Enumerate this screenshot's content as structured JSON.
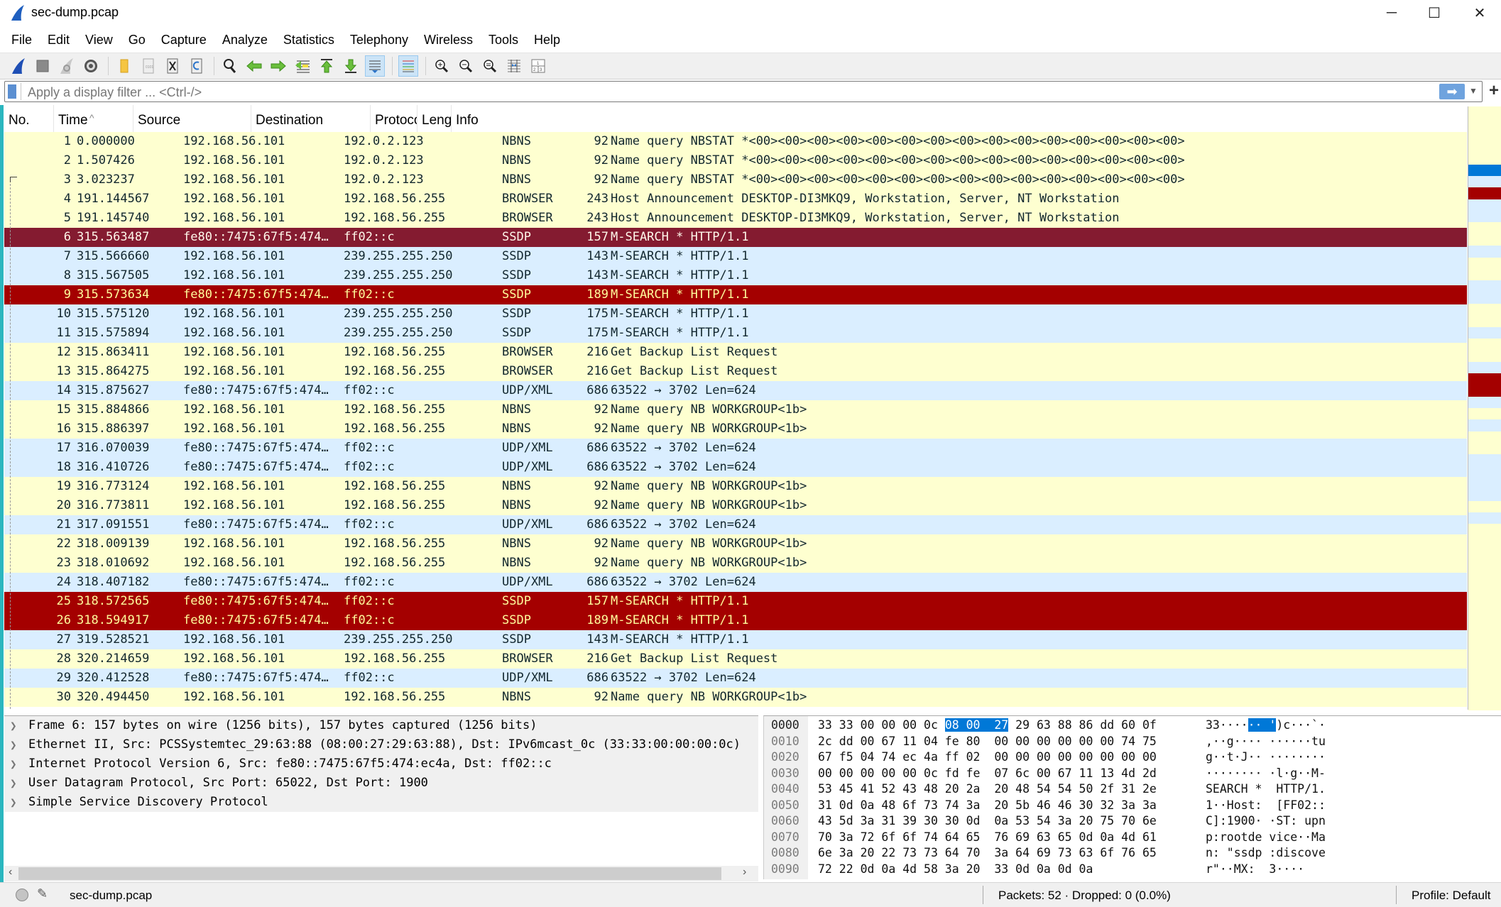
{
  "window": {
    "title": "sec-dump.pcap",
    "controls": {
      "minimize": "─",
      "maximize": "☐",
      "close": "✕"
    }
  },
  "menu": [
    "File",
    "Edit",
    "View",
    "Go",
    "Capture",
    "Analyze",
    "Statistics",
    "Telephony",
    "Wireless",
    "Tools",
    "Help"
  ],
  "toolbar": [
    {
      "name": "start-capture",
      "icon": "shark-fin-icon"
    },
    {
      "name": "stop-capture",
      "icon": "stop-icon"
    },
    {
      "name": "restart-capture",
      "icon": "restart-icon"
    },
    {
      "name": "capture-options",
      "icon": "gear-icon"
    },
    {
      "name": "open-file",
      "icon": "folder-icon"
    },
    {
      "name": "save-file",
      "icon": "file-icon"
    },
    {
      "name": "close-file",
      "icon": "close-file-icon"
    },
    {
      "name": "reload-file",
      "icon": "reload-icon"
    },
    {
      "name": "find-packet",
      "icon": "magnifier-icon"
    },
    {
      "name": "go-back",
      "icon": "arrow-left-icon"
    },
    {
      "name": "go-forward",
      "icon": "arrow-right-icon"
    },
    {
      "name": "go-to-packet",
      "icon": "jump-icon"
    },
    {
      "name": "go-first",
      "icon": "arrow-top-icon"
    },
    {
      "name": "go-last",
      "icon": "arrow-bottom-icon"
    },
    {
      "name": "auto-scroll",
      "icon": "autoscroll-icon",
      "active": true
    },
    {
      "name": "colorize",
      "icon": "colorize-icon",
      "active": true
    },
    {
      "name": "zoom-in",
      "icon": "zoom-in-icon"
    },
    {
      "name": "zoom-out",
      "icon": "zoom-out-icon"
    },
    {
      "name": "zoom-reset",
      "icon": "zoom-reset-icon"
    },
    {
      "name": "resize-columns",
      "icon": "resize-columns-icon"
    },
    {
      "name": "layout",
      "icon": "layout-icon"
    }
  ],
  "filter": {
    "placeholder": "Apply a display filter ... <Ctrl-/>",
    "value": "",
    "apply_label": "➡",
    "plus_label": "+"
  },
  "columns": [
    "No.",
    "Time",
    "Source",
    "Destination",
    "Protocol",
    "Length",
    "Info"
  ],
  "columns_display": [
    "No.",
    "Time",
    "Source",
    "Destination",
    "Protocol",
    "Lengtl",
    "Info"
  ],
  "colors": {
    "yellow": "#feffd0",
    "blue": "#daeeff",
    "red": "#a40000",
    "selected": "#841b30",
    "highlight": "#0078d7"
  },
  "packets": [
    {
      "no": "1",
      "time": "0.000000",
      "src": "192.168.56.101",
      "dst": "192.0.2.123",
      "proto": "NBNS",
      "len": "92",
      "info": "Name query NBSTAT *<00><00><00><00><00><00><00><00><00><00><00><00><00><00><00>",
      "color": "yellow"
    },
    {
      "no": "2",
      "time": "1.507426",
      "src": "192.168.56.101",
      "dst": "192.0.2.123",
      "proto": "NBNS",
      "len": "92",
      "info": "Name query NBSTAT *<00><00><00><00><00><00><00><00><00><00><00><00><00><00><00>",
      "color": "yellow"
    },
    {
      "no": "3",
      "time": "3.023237",
      "src": "192.168.56.101",
      "dst": "192.0.2.123",
      "proto": "NBNS",
      "len": "92",
      "info": "Name query NBSTAT *<00><00><00><00><00><00><00><00><00><00><00><00><00><00><00>",
      "color": "yellow"
    },
    {
      "no": "4",
      "time": "191.144567",
      "src": "192.168.56.101",
      "dst": "192.168.56.255",
      "proto": "BROWSER",
      "len": "243",
      "info": "Host Announcement DESKTOP-DI3MKQ9, Workstation, Server, NT Workstation",
      "color": "yellow"
    },
    {
      "no": "5",
      "time": "191.145740",
      "src": "192.168.56.101",
      "dst": "192.168.56.255",
      "proto": "BROWSER",
      "len": "243",
      "info": "Host Announcement DESKTOP-DI3MKQ9, Workstation, Server, NT Workstation",
      "color": "yellow"
    },
    {
      "no": "6",
      "time": "315.563487",
      "src": "fe80::7475:67f5:474…",
      "dst": "ff02::c",
      "proto": "SSDP",
      "len": "157",
      "info": "M-SEARCH * HTTP/1.1",
      "color": "selected"
    },
    {
      "no": "7",
      "time": "315.566660",
      "src": "192.168.56.101",
      "dst": "239.255.255.250",
      "proto": "SSDP",
      "len": "143",
      "info": "M-SEARCH * HTTP/1.1",
      "color": "blue"
    },
    {
      "no": "8",
      "time": "315.567505",
      "src": "192.168.56.101",
      "dst": "239.255.255.250",
      "proto": "SSDP",
      "len": "143",
      "info": "M-SEARCH * HTTP/1.1",
      "color": "blue"
    },
    {
      "no": "9",
      "time": "315.573634",
      "src": "fe80::7475:67f5:474…",
      "dst": "ff02::c",
      "proto": "SSDP",
      "len": "189",
      "info": "M-SEARCH * HTTP/1.1",
      "color": "red"
    },
    {
      "no": "10",
      "time": "315.575120",
      "src": "192.168.56.101",
      "dst": "239.255.255.250",
      "proto": "SSDP",
      "len": "175",
      "info": "M-SEARCH * HTTP/1.1",
      "color": "blue"
    },
    {
      "no": "11",
      "time": "315.575894",
      "src": "192.168.56.101",
      "dst": "239.255.255.250",
      "proto": "SSDP",
      "len": "175",
      "info": "M-SEARCH * HTTP/1.1",
      "color": "blue"
    },
    {
      "no": "12",
      "time": "315.863411",
      "src": "192.168.56.101",
      "dst": "192.168.56.255",
      "proto": "BROWSER",
      "len": "216",
      "info": "Get Backup List Request",
      "color": "yellow"
    },
    {
      "no": "13",
      "time": "315.864275",
      "src": "192.168.56.101",
      "dst": "192.168.56.255",
      "proto": "BROWSER",
      "len": "216",
      "info": "Get Backup List Request",
      "color": "yellow"
    },
    {
      "no": "14",
      "time": "315.875627",
      "src": "fe80::7475:67f5:474…",
      "dst": "ff02::c",
      "proto": "UDP/XML",
      "len": "686",
      "info": "63522 → 3702 Len=624",
      "color": "blue"
    },
    {
      "no": "15",
      "time": "315.884866",
      "src": "192.168.56.101",
      "dst": "192.168.56.255",
      "proto": "NBNS",
      "len": "92",
      "info": "Name query NB WORKGROUP<1b>",
      "color": "yellow"
    },
    {
      "no": "16",
      "time": "315.886397",
      "src": "192.168.56.101",
      "dst": "192.168.56.255",
      "proto": "NBNS",
      "len": "92",
      "info": "Name query NB WORKGROUP<1b>",
      "color": "yellow"
    },
    {
      "no": "17",
      "time": "316.070039",
      "src": "fe80::7475:67f5:474…",
      "dst": "ff02::c",
      "proto": "UDP/XML",
      "len": "686",
      "info": "63522 → 3702 Len=624",
      "color": "blue"
    },
    {
      "no": "18",
      "time": "316.410726",
      "src": "fe80::7475:67f5:474…",
      "dst": "ff02::c",
      "proto": "UDP/XML",
      "len": "686",
      "info": "63522 → 3702 Len=624",
      "color": "blue"
    },
    {
      "no": "19",
      "time": "316.773124",
      "src": "192.168.56.101",
      "dst": "192.168.56.255",
      "proto": "NBNS",
      "len": "92",
      "info": "Name query NB WORKGROUP<1b>",
      "color": "yellow"
    },
    {
      "no": "20",
      "time": "316.773811",
      "src": "192.168.56.101",
      "dst": "192.168.56.255",
      "proto": "NBNS",
      "len": "92",
      "info": "Name query NB WORKGROUP<1b>",
      "color": "yellow"
    },
    {
      "no": "21",
      "time": "317.091551",
      "src": "fe80::7475:67f5:474…",
      "dst": "ff02::c",
      "proto": "UDP/XML",
      "len": "686",
      "info": "63522 → 3702 Len=624",
      "color": "blue"
    },
    {
      "no": "22",
      "time": "318.009139",
      "src": "192.168.56.101",
      "dst": "192.168.56.255",
      "proto": "NBNS",
      "len": "92",
      "info": "Name query NB WORKGROUP<1b>",
      "color": "yellow"
    },
    {
      "no": "23",
      "time": "318.010692",
      "src": "192.168.56.101",
      "dst": "192.168.56.255",
      "proto": "NBNS",
      "len": "92",
      "info": "Name query NB WORKGROUP<1b>",
      "color": "yellow"
    },
    {
      "no": "24",
      "time": "318.407182",
      "src": "fe80::7475:67f5:474…",
      "dst": "ff02::c",
      "proto": "UDP/XML",
      "len": "686",
      "info": "63522 → 3702 Len=624",
      "color": "blue"
    },
    {
      "no": "25",
      "time": "318.572565",
      "src": "fe80::7475:67f5:474…",
      "dst": "ff02::c",
      "proto": "SSDP",
      "len": "157",
      "info": "M-SEARCH * HTTP/1.1",
      "color": "red"
    },
    {
      "no": "26",
      "time": "318.594917",
      "src": "fe80::7475:67f5:474…",
      "dst": "ff02::c",
      "proto": "SSDP",
      "len": "189",
      "info": "M-SEARCH * HTTP/1.1",
      "color": "red"
    },
    {
      "no": "27",
      "time": "319.528521",
      "src": "192.168.56.101",
      "dst": "239.255.255.250",
      "proto": "SSDP",
      "len": "143",
      "info": "M-SEARCH * HTTP/1.1",
      "color": "blue"
    },
    {
      "no": "28",
      "time": "320.214659",
      "src": "192.168.56.101",
      "dst": "192.168.56.255",
      "proto": "BROWSER",
      "len": "216",
      "info": "Get Backup List Request",
      "color": "yellow"
    },
    {
      "no": "29",
      "time": "320.412528",
      "src": "fe80::7475:67f5:474…",
      "dst": "ff02::c",
      "proto": "UDP/XML",
      "len": "686",
      "info": "63522 → 3702 Len=624",
      "color": "blue"
    },
    {
      "no": "30",
      "time": "320.494450",
      "src": "192.168.56.101",
      "dst": "192.168.56.255",
      "proto": "NBNS",
      "len": "92",
      "info": "Name query NB WORKGROUP<1b>",
      "color": "yellow"
    }
  ],
  "minimap": [
    "yellow",
    "yellow",
    "yellow",
    "yellow",
    "yellow",
    "highlight",
    "blue",
    "red",
    "blue",
    "blue",
    "yellow",
    "yellow",
    "blue",
    "yellow",
    "yellow",
    "blue",
    "blue",
    "yellow",
    "yellow",
    "blue",
    "yellow",
    "yellow",
    "blue",
    "red",
    "red",
    "blue",
    "yellow",
    "blue",
    "yellow",
    "yellow",
    "blue",
    "blue",
    "blue",
    "blue",
    "yellow",
    "blue",
    "yellow",
    "yellow",
    "yellow",
    "yellow",
    "yellow",
    "yellow",
    "yellow",
    "yellow",
    "yellow",
    "yellow",
    "yellow",
    "yellow",
    "yellow",
    "yellow",
    "yellow",
    "yellow"
  ],
  "details": [
    "Frame 6: 157 bytes on wire (1256 bits), 157 bytes captured (1256 bits)",
    "Ethernet II, Src: PCSSystemtec_29:63:88 (08:00:27:29:63:88), Dst: IPv6mcast_0c (33:33:00:00:00:0c)",
    "Internet Protocol Version 6, Src: fe80::7475:67f5:474:ec4a, Dst: ff02::c",
    "User Datagram Protocol, Src Port: 65022, Dst Port: 1900",
    "Simple Service Discovery Protocol"
  ],
  "hex": [
    {
      "off": "0000",
      "pre": "33 33 00 00 00 0c ",
      "hl": "08 00  27",
      "post": " 29 63 88 86 dd 60 0f",
      "apre": "33····",
      "ahl": "·· '",
      "apost": ")c···`·"
    },
    {
      "off": "0010",
      "pre": "2c dd 00 67 11 04 fe 80  00 00 00 00 00 00 74 75",
      "hl": "",
      "post": "",
      "apre": ",··g···· ······tu",
      "ahl": "",
      "apost": ""
    },
    {
      "off": "0020",
      "pre": "67 f5 04 74 ec 4a ff 02  00 00 00 00 00 00 00 00",
      "hl": "",
      "post": "",
      "apre": "g··t·J·· ········",
      "ahl": "",
      "apost": ""
    },
    {
      "off": "0030",
      "pre": "00 00 00 00 00 0c fd fe  07 6c 00 67 11 13 4d 2d",
      "hl": "",
      "post": "",
      "apre": "········ ·l·g··M-",
      "ahl": "",
      "apost": ""
    },
    {
      "off": "0040",
      "pre": "53 45 41 52 43 48 20 2a  20 48 54 54 50 2f 31 2e",
      "hl": "",
      "post": "",
      "apre": "SEARCH *  HTTP/1.",
      "ahl": "",
      "apost": ""
    },
    {
      "off": "0050",
      "pre": "31 0d 0a 48 6f 73 74 3a  20 5b 46 46 30 32 3a 3a",
      "hl": "",
      "post": "",
      "apre": "1··Host:  [FF02::",
      "ahl": "",
      "apost": ""
    },
    {
      "off": "0060",
      "pre": "43 5d 3a 31 39 30 30 0d  0a 53 54 3a 20 75 70 6e",
      "hl": "",
      "post": "",
      "apre": "C]:1900· ·ST: upn",
      "ahl": "",
      "apost": ""
    },
    {
      "off": "0070",
      "pre": "70 3a 72 6f 6f 74 64 65  76 69 63 65 0d 0a 4d 61",
      "hl": "",
      "post": "",
      "apre": "p:rootde vice··Ma",
      "ahl": "",
      "apost": ""
    },
    {
      "off": "0080",
      "pre": "6e 3a 20 22 73 73 64 70  3a 64 69 73 63 6f 76 65",
      "hl": "",
      "post": "",
      "apre": "n: \"ssdp :discove",
      "ahl": "",
      "apost": ""
    },
    {
      "off": "0090",
      "pre": "72 22 0d 0a 4d 58 3a 20  33 0d 0a 0d 0a",
      "hl": "",
      "post": "",
      "apre": "r\"··MX:  3····",
      "ahl": "",
      "apost": ""
    }
  ],
  "status": {
    "file": "sec-dump.pcap",
    "packets": "Packets: 52 · Dropped: 0 (0.0%)",
    "profile": "Profile: Default"
  }
}
